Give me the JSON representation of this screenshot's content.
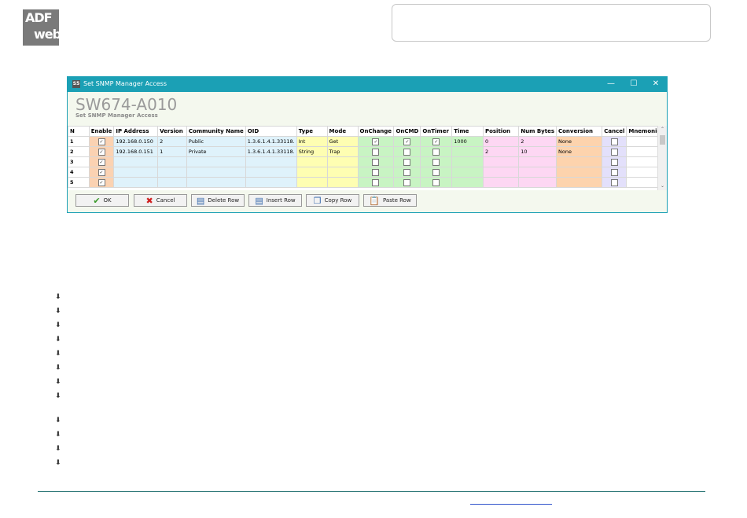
{
  "logo": {
    "line1": "ADF",
    "line2": "web"
  },
  "window": {
    "app_icon": "S5",
    "title": "Set SNMP Manager Access",
    "minimize": "—",
    "maximize": "☐",
    "close": "✕"
  },
  "page": {
    "title": "SW674-A010",
    "subtitle": "Set SNMP Manager Access"
  },
  "table": {
    "columns": [
      "N",
      "Enable",
      "IP Address",
      "Version",
      "Community Name",
      "OID",
      "Type",
      "Mode",
      "OnChange",
      "OnCMD",
      "OnTimer",
      "Time",
      "Position",
      "Num Bytes",
      "Conversion",
      "Cancel",
      "Mnemonic"
    ],
    "rows": [
      {
        "n": "1",
        "enable": true,
        "ip": "192.168.0.150",
        "version": "2",
        "community": "Public",
        "oid": "1.3.6.1.4.1.33118.",
        "type": "Int",
        "mode": "Get",
        "onchange": true,
        "oncmd": true,
        "ontimer": true,
        "time": "1000",
        "position": "0",
        "numbytes": "2",
        "conversion": "None",
        "cancel": false,
        "mnemonic": ""
      },
      {
        "n": "2",
        "enable": true,
        "ip": "192.168.0.151",
        "version": "1",
        "community": "Private",
        "oid": "1.3.6.1.4.1.33118.",
        "type": "String",
        "mode": "Trap",
        "onchange": false,
        "oncmd": false,
        "ontimer": false,
        "time": "",
        "position": "2",
        "numbytes": "10",
        "conversion": "None",
        "cancel": false,
        "mnemonic": ""
      },
      {
        "n": "3",
        "enable": true,
        "ip": "",
        "version": "",
        "community": "",
        "oid": "",
        "type": "",
        "mode": "",
        "onchange": false,
        "oncmd": false,
        "ontimer": false,
        "time": "",
        "position": "",
        "numbytes": "",
        "conversion": "",
        "cancel": false,
        "mnemonic": ""
      },
      {
        "n": "4",
        "enable": true,
        "ip": "",
        "version": "",
        "community": "",
        "oid": "",
        "type": "",
        "mode": "",
        "onchange": false,
        "oncmd": false,
        "ontimer": false,
        "time": "",
        "position": "",
        "numbytes": "",
        "conversion": "",
        "cancel": false,
        "mnemonic": ""
      },
      {
        "n": "5",
        "enable": true,
        "ip": "",
        "version": "",
        "community": "",
        "oid": "",
        "type": "",
        "mode": "",
        "onchange": false,
        "oncmd": false,
        "ontimer": false,
        "time": "",
        "position": "",
        "numbytes": "",
        "conversion": "",
        "cancel": false,
        "mnemonic": ""
      }
    ]
  },
  "scroll": {
    "up": "⌃",
    "down": "⌄"
  },
  "buttons": {
    "ok": {
      "label": "OK",
      "icon": "✔"
    },
    "cancel": {
      "label": "Cancel",
      "icon": "✖"
    },
    "delete_row": {
      "label": "Delete Row",
      "icon": "▤"
    },
    "insert_row": {
      "label": "Insert Row",
      "icon": "▤"
    },
    "copy_row": {
      "label": "Copy Row",
      "icon": "❐"
    },
    "paste_row": {
      "label": "Paste Row",
      "icon": "📋"
    }
  },
  "bullet_icon": "arrow-down-bullet-icon",
  "bullet_glyph": "⬇",
  "colors": {
    "titlebar": "#1ba0b5",
    "accent_line": "#1a6b6b",
    "link": "#3355cc"
  }
}
